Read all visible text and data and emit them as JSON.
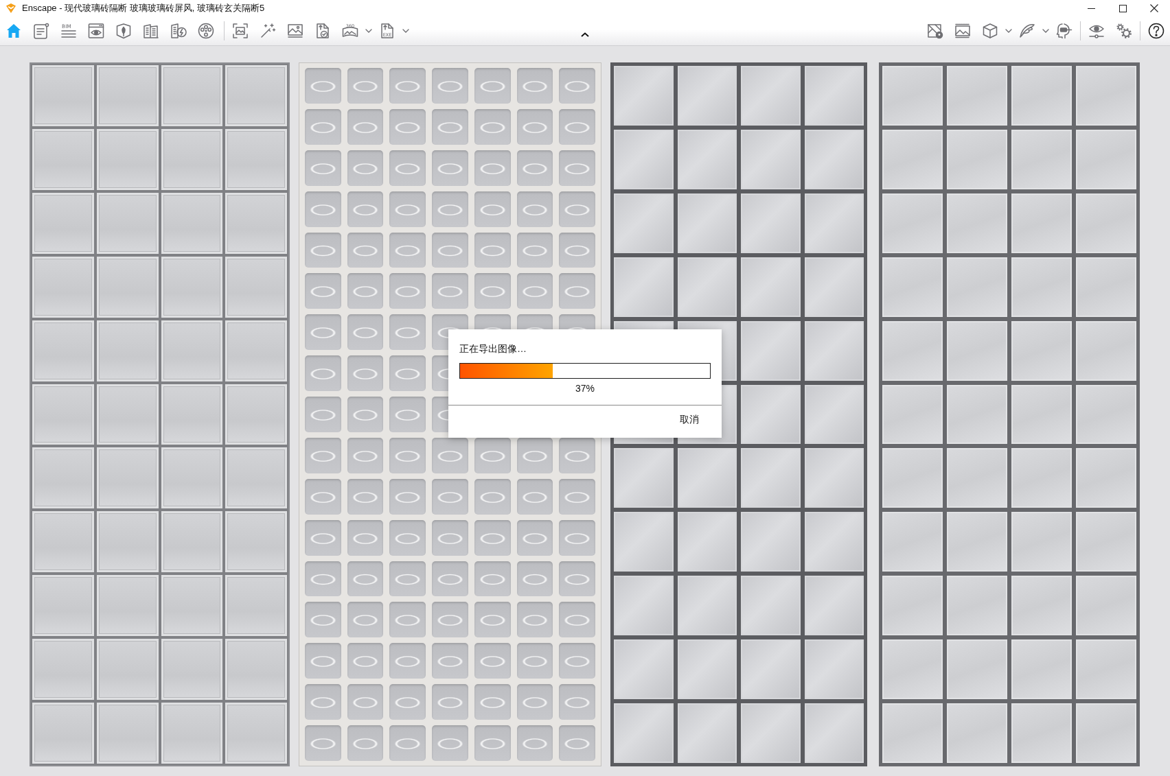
{
  "window": {
    "title": "Enscape - 现代玻璃砖隔断 玻璃玻璃砖屏风, 玻璃砖玄关隔断5"
  },
  "toolbar": {
    "left_groups": [
      {
        "items": [
          {
            "selected": true,
            "dropdown": false
          },
          {
            "selected": false,
            "dropdown": false
          },
          {
            "selected": false,
            "dropdown": false,
            "label": "BIM"
          },
          {
            "selected": false,
            "dropdown": false
          },
          {
            "selected": false,
            "dropdown": false
          },
          {
            "selected": false,
            "dropdown": false
          },
          {
            "selected": false,
            "dropdown": false
          },
          {
            "selected": false,
            "dropdown": false
          }
        ]
      },
      {
        "items": [
          {
            "selected": false,
            "dropdown": false
          },
          {
            "selected": false,
            "dropdown": false
          },
          {
            "selected": false,
            "dropdown": false
          },
          {
            "selected": false,
            "dropdown": false
          },
          {
            "selected": false,
            "dropdown": true,
            "label": "360"
          },
          {
            "selected": false,
            "dropdown": true,
            "label": "EXE"
          }
        ]
      }
    ],
    "right_groups": [
      {
        "items": [
          {
            "selected": false,
            "dropdown": false
          },
          {
            "selected": false,
            "dropdown": false
          },
          {
            "selected": false,
            "dropdown": true
          },
          {
            "selected": false,
            "dropdown": true
          },
          {
            "selected": false,
            "dropdown": false
          }
        ]
      },
      {
        "items": [
          {
            "selected": false,
            "dropdown": false
          },
          {
            "selected": false,
            "dropdown": false
          }
        ]
      },
      {
        "items": [
          {
            "selected": false,
            "dropdown": false
          }
        ]
      }
    ]
  },
  "export_dialog": {
    "message": "正在导出图像…",
    "progress": {
      "level": 0.37
    },
    "percent": "37%",
    "cancel_button": "取消"
  }
}
